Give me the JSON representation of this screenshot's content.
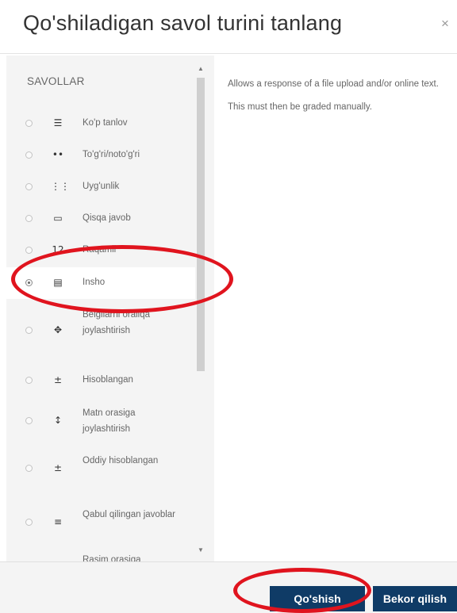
{
  "dialog": {
    "title": "Qo'shiladigan savol turini tanlang",
    "close_glyph": "×"
  },
  "sidebar": {
    "section_label": "SAVOLLAR",
    "items": [
      {
        "label": "Ko'p tanlov",
        "icon": "list-icon",
        "glyph": "☰",
        "selected": false
      },
      {
        "label": "To'g'ri/noto'g'ri",
        "icon": "dots-icon",
        "glyph": "••",
        "selected": false
      },
      {
        "label": "Uyg'unlik",
        "icon": "grid-icon",
        "glyph": "⋮⋮",
        "selected": false
      },
      {
        "label": "Qisqa javob",
        "icon": "textbox-icon",
        "glyph": "▭",
        "selected": false
      },
      {
        "label": "Raqamli",
        "icon": "numeric-icon",
        "glyph": "12",
        "selected": false
      },
      {
        "label": "Insho",
        "icon": "essay-icon",
        "glyph": "▤",
        "selected": true
      },
      {
        "label": "Belgilarni oraliqa joylashtirish",
        "icon": "drag-icon",
        "glyph": "✥",
        "selected": false
      },
      {
        "label": "Hisoblangan",
        "icon": "calculated-icon",
        "glyph": "±",
        "selected": false
      },
      {
        "label": "Matn orasiga joylashtirish",
        "icon": "move-icon",
        "glyph": "↕",
        "selected": false
      },
      {
        "label": "Oddiy hisoblangan",
        "icon": "simple-calculated-icon",
        "glyph": "±",
        "selected": false
      },
      {
        "label": "Qabul qilingan javoblar",
        "icon": "accepted-answers-icon",
        "glyph": "≡",
        "selected": false
      },
      {
        "label": "Rasim orasiga",
        "icon": "image-drop-icon",
        "glyph": "▦",
        "selected": false
      }
    ]
  },
  "description": "Allows a response of a file upload and/or online text. This must then be graded manually.",
  "footer": {
    "add_label": "Qo'shish",
    "cancel_label": "Bekor qilish"
  },
  "colors": {
    "primary_button": "#0f3b66",
    "annotation": "#e0141e",
    "sidebar_bg": "#f4f4f4"
  }
}
